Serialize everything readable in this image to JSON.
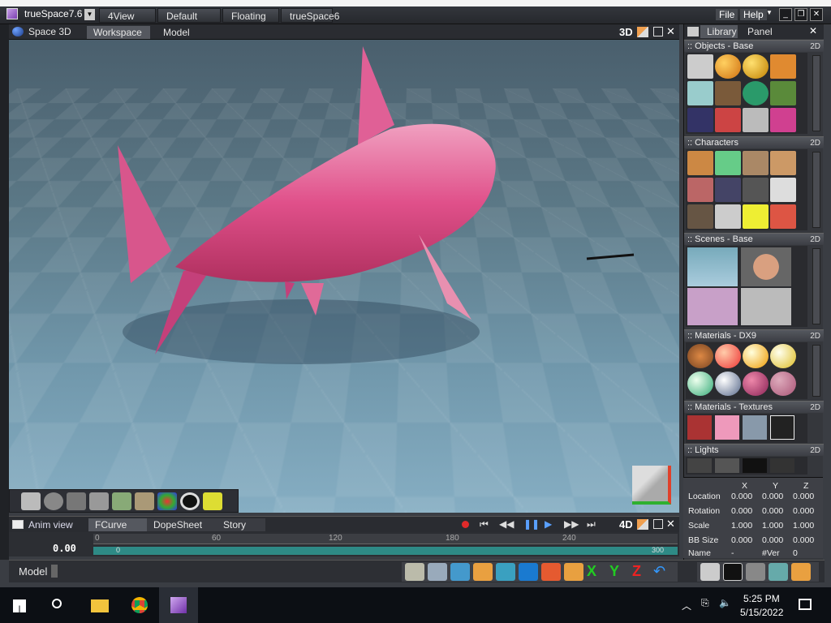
{
  "app": {
    "title": "trueSpace7.6",
    "top_tabs": [
      "4View",
      "Default",
      "Floating",
      "trueSpace6"
    ],
    "menu": [
      "File",
      "Help"
    ]
  },
  "viewport": {
    "space_label": "Space 3D",
    "tabs": [
      "Workspace",
      "Model"
    ],
    "mode": "3D"
  },
  "library": {
    "tabs": [
      "Library",
      "Panel"
    ],
    "sections": [
      {
        "title": ":: Objects - Base",
        "mode": "2D"
      },
      {
        "title": ":: Characters",
        "mode": "2D"
      },
      {
        "title": ":: Scenes - Base",
        "mode": "2D"
      },
      {
        "title": ":: Materials - DX9",
        "mode": "2D"
      },
      {
        "title": ":: Materials - Textures",
        "mode": "2D"
      },
      {
        "title": ":: Lights",
        "mode": "2D"
      }
    ]
  },
  "properties": {
    "headers": [
      "X",
      "Y",
      "Z"
    ],
    "rows": [
      {
        "label": "Location",
        "x": "0.000",
        "y": "0.000",
        "z": "0.000"
      },
      {
        "label": "Rotation",
        "x": "0.000",
        "y": "0.000",
        "z": "0.000"
      },
      {
        "label": "Scale",
        "x": "1.000",
        "y": "1.000",
        "z": "1.000"
      },
      {
        "label": "BB Size",
        "x": "0.000",
        "y": "0.000",
        "z": "0.000"
      },
      {
        "label": "Name",
        "x": "-",
        "y": "#Ver",
        "z": "0"
      }
    ]
  },
  "anim": {
    "label": "Anim view",
    "tabs": [
      "FCurve",
      "DopeSheet",
      "Story"
    ],
    "mode": "4D",
    "frame": "0.00",
    "ruler": [
      "0",
      "60",
      "120",
      "180",
      "240"
    ],
    "start": "0",
    "end": "300"
  },
  "command": {
    "label": "Model"
  },
  "taskbar": {
    "time": "5:25 PM",
    "date": "5/15/2022"
  },
  "colors": {
    "accent_orange": "#e08a3a",
    "shark_pink": "#e0508a"
  }
}
